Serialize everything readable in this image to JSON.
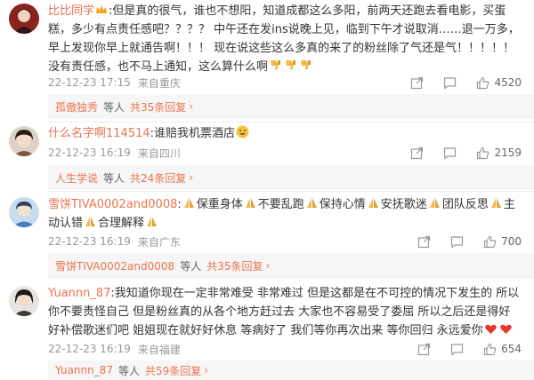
{
  "comments": [
    {
      "username": "比比同学",
      "text_part1": ":但是真的很气，谁也不想阳，知道成都这么多阳，前两天还跑去看电影，买蛋糕，多少有点责任感吧？？？？ 中午还在发ins说晚上见，临到下午才说取消……退一万多，早上发现你早上就通告啊！！！ 现在说这些这么多真的来了的粉丝除了气还是气！！！！！没有责任感，也不马上通知，这么算什么啊",
      "time": "22-12-23 17:15",
      "location": "来自重庆",
      "likes": "4520",
      "reply_user": "孤傲独秀",
      "reply_mid": "等人",
      "reply_count": "共35条回复",
      "reply_arrow": "›"
    },
    {
      "username": "什么名字啊114514",
      "text_part1": ":谁赔我机票酒店",
      "time": "22-12-23 16:19",
      "location": "来自四川",
      "likes": "2159",
      "reply_user": "人生学说",
      "reply_mid": "等人",
      "reply_count": "共24条回复",
      "reply_arrow": "›"
    },
    {
      "username": "雪饼TIVA0002and0008",
      "segments": [
        ":",
        "保重身体",
        "不要乱跑",
        "保持心情",
        "安抚歌迷",
        "团队反思",
        "主动认错",
        "合理解释"
      ],
      "time": "22-12-23 16:19",
      "location": "来自广东",
      "likes": "700",
      "reply_user": "雪饼TIVA0002and0008",
      "reply_mid": "等人",
      "reply_count": "共35条回复",
      "reply_arrow": "›"
    },
    {
      "username": "Yuannn_87",
      "text_part1": ":我知道你现在一定非常难受 非常难过 但是这都是在不可控的情况下发生的 所以你不要责怪自己 但是粉丝真的从各个地方赶过去 大家也不容易受了委屈 所以之后还是得好好补偿歌迷们吧 姐姐现在就好好休息 等病好了 我们等你再次出来 等你回归 永远爱你",
      "time": "22-12-23 16:19",
      "location": "来自福建",
      "likes": "654",
      "reply_user": "Yuannn_87",
      "reply_mid": "等人",
      "reply_count": "共59条回复",
      "reply_arrow": "›"
    }
  ],
  "icons": {
    "share": "share-icon",
    "comment": "comment-icon",
    "like": "like-icon",
    "crown": "crown-icon",
    "thumbs_down": "thumbs-down-emoji",
    "grin": "grin-emoji",
    "pray": "pray-emoji",
    "heart": "heart-emoji"
  },
  "colors": {
    "username": "#eb7350",
    "meta": "#999999",
    "reply_bg": "#f6f6f6"
  }
}
